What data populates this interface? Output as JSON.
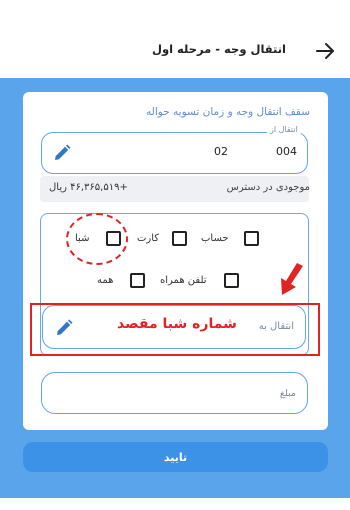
{
  "header": {
    "title": "انتقال وجه - مرحله اول",
    "back_icon": "arrow-right-icon"
  },
  "form": {
    "section_title": "سقف انتقال وجه و زمان تسویه حواله",
    "from_account": {
      "label": "انتقال از",
      "account_number": "004",
      "branch_code": "02",
      "icon": "pencil-icon"
    },
    "balance": {
      "label": "موجودی در دسترس",
      "value": "+۴۶,۳۶۵,۵۱۹ ریال"
    },
    "destination_types": [
      {
        "label": "حساب",
        "checked": false
      },
      {
        "label": "کارت",
        "checked": false
      },
      {
        "label": "شبا",
        "checked": false
      },
      {
        "label": "تلفن همراه",
        "checked": false
      },
      {
        "label": "همه",
        "checked": false
      }
    ],
    "to_account": {
      "label": "انتقال به",
      "annotation": "شماره شبا مقصد",
      "icon": "pencil-icon"
    },
    "amount": {
      "placeholder": "مبلغ"
    },
    "confirm_label": "تایید"
  },
  "colors": {
    "accent": "#3c92e6",
    "band": "#5aa4ec",
    "annotation": "#e02424"
  }
}
